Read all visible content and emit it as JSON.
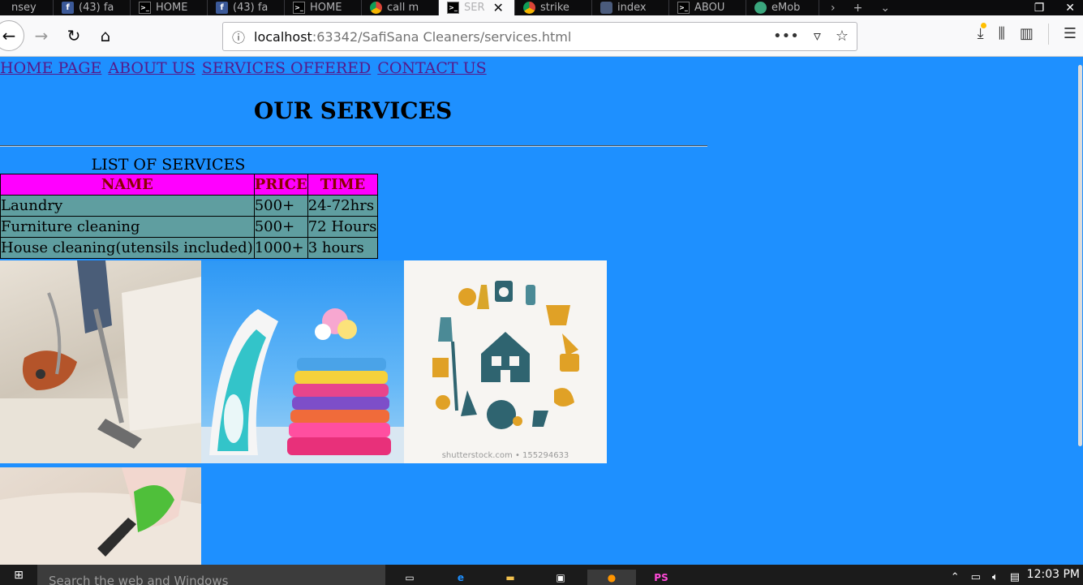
{
  "browser": {
    "tabs": [
      {
        "title": "nsey",
        "icon": "generic-icon"
      },
      {
        "title": "(43) fa",
        "icon": "facebook-icon"
      },
      {
        "title": "HOME",
        "icon": "code-icon"
      },
      {
        "title": "(43) fa",
        "icon": "facebook-icon"
      },
      {
        "title": "HOME",
        "icon": "code-icon"
      },
      {
        "title": "call m",
        "icon": "chrome-icon"
      },
      {
        "title": "SER",
        "icon": "code-icon",
        "active": true
      },
      {
        "title": "strike",
        "icon": "chrome-icon"
      },
      {
        "title": "index",
        "icon": "shield-icon"
      },
      {
        "title": "ABOU",
        "icon": "code-icon"
      },
      {
        "title": "eMob",
        "icon": "green-icon"
      }
    ],
    "url_host": "localhost",
    "url_rest": ":63342/SafiSana Cleaners/services.html"
  },
  "page": {
    "menu": [
      "HOME PAGE",
      "ABOUT US",
      "SERVICES OFFERED",
      "CONTACT US"
    ],
    "heading": "OUR SERVICES",
    "table_caption": "LIST OF SERVICES",
    "table_headers": [
      "NAME",
      "PRICE",
      "TIME"
    ],
    "table_rows": [
      [
        "Laundry",
        "500+",
        "24-72hrs"
      ],
      [
        "Furniture cleaning",
        "500+",
        "72 Hours"
      ],
      [
        "House cleaning(utensils included)",
        "1000+",
        "3 hours"
      ]
    ],
    "watermark": "shutterstock.com • 155294633",
    "colors": {
      "page_bg": "#1e90ff",
      "header_bg": "#ff00ff",
      "header_text": "#8b0000",
      "cell_bg": "#5f9ea0"
    }
  },
  "taskbar": {
    "search_placeholder": "Search the web and Windows",
    "time": "12:03 PM"
  }
}
